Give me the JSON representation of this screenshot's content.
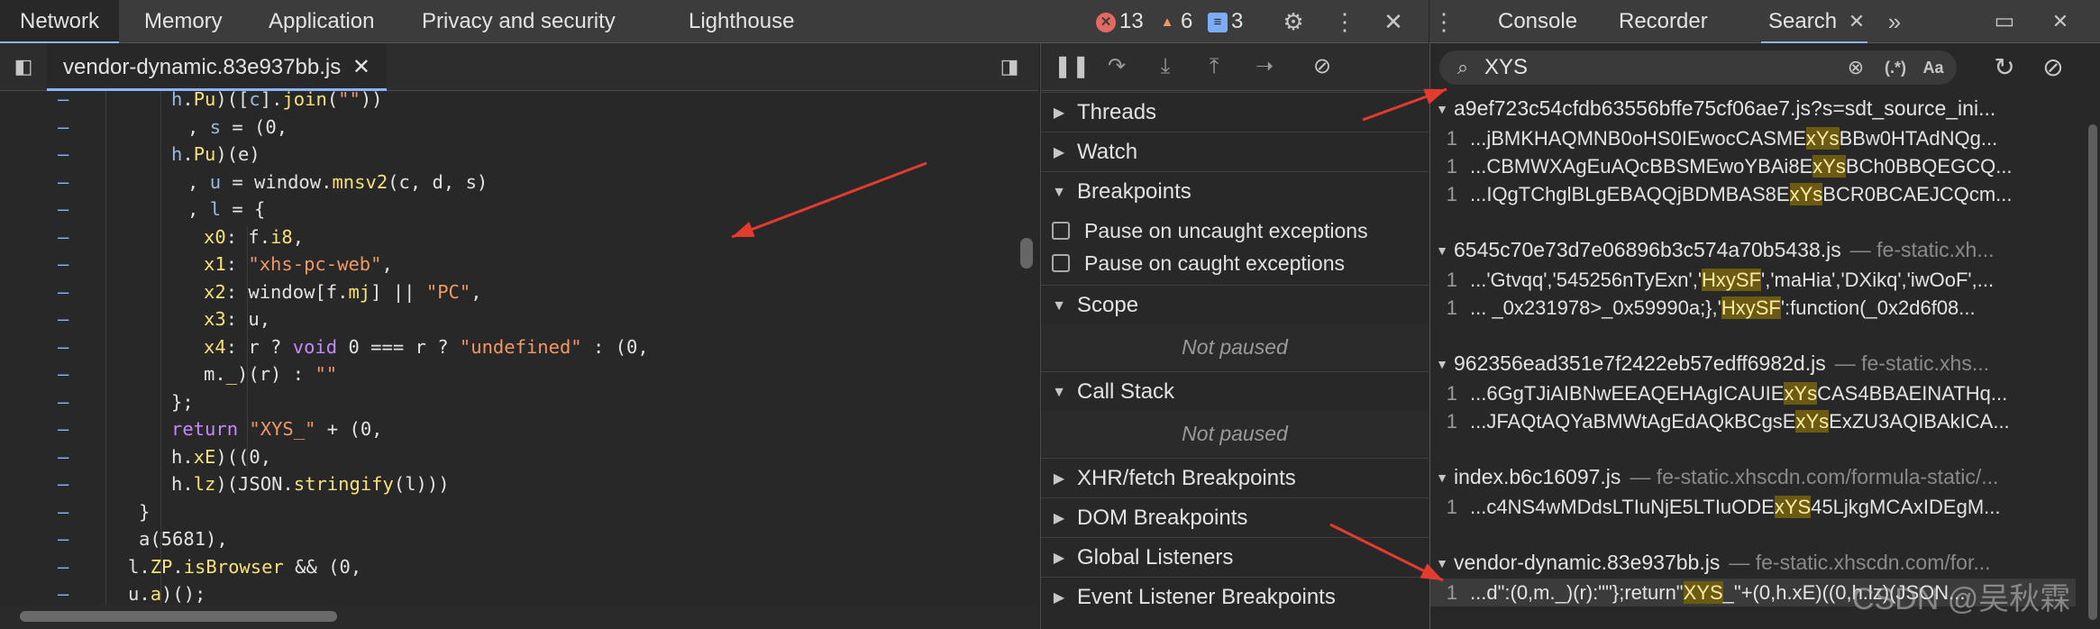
{
  "top_tabs": [
    "Network",
    "Memory",
    "Application",
    "Privacy and security",
    "Lighthouse"
  ],
  "active_top_tab": "Network",
  "counts": {
    "errors": "13",
    "warnings": "6",
    "messages": "3"
  },
  "right_tabs": {
    "console": "Console",
    "recorder": "Recorder",
    "search": "Search"
  },
  "editor": {
    "file_tab": "vendor-dynamic.83e937bb.js",
    "lines": [
      {
        "html": "<span class=\"prop\">h</span>.<span class=\"fn\">Pu</span>)([<span class=\"prop\">c</span>].<span class=\"fn\">join</span>(<span class=\"str\">\"\"</span>))",
        "indent": 190
      },
      {
        "html": ", <span class=\"prop\">s</span> = (0,",
        "indent": 208
      },
      {
        "html": "<span class=\"prop\">h</span>.<span class=\"fn\">Pu</span>)(e)",
        "indent": 190
      },
      {
        "html": ", <span class=\"prop\">u</span> = window.<span class=\"fn\">mnsv2</span>(c, d, s)",
        "indent": 208
      },
      {
        "html": ", <span class=\"prop\">l</span> = {",
        "indent": 208
      },
      {
        "html": "<span class=\"fn\">x0</span>: f.<span class=\"fn\">i8</span>,",
        "indent": 226
      },
      {
        "html": "<span class=\"fn\">x1</span>: <span class=\"str\">\"xhs-pc-web\"</span>,",
        "indent": 226
      },
      {
        "html": "<span class=\"fn\">x2</span>: window[f.<span class=\"fn\">mj</span>] || <span class=\"str\">\"PC\"</span>,",
        "indent": 226
      },
      {
        "html": "<span class=\"fn\">x3</span>: u,",
        "indent": 226
      },
      {
        "html": "<span class=\"fn\">x4</span>: r ? <span class=\"kw\">void</span> 0 === r ? <span class=\"str\">\"undefined\"</span> : (0,",
        "indent": 226
      },
      {
        "html": "m.<span class=\"fn\">_</span>)(r) : <span class=\"str\">\"\"</span>",
        "indent": 226
      },
      {
        "html": "};",
        "indent": 190
      },
      {
        "html": "<span class=\"kw\">return</span> <span class=\"str\">\"XYS_\"</span> + (0,",
        "indent": 190
      },
      {
        "html": "h.<span class=\"fn\">xE</span>)((0,",
        "indent": 190
      },
      {
        "html": "h.<span class=\"fn\">lz</span>)(JSON.<span class=\"fn\">stringify</span>(l)))",
        "indent": 190
      },
      {
        "html": "}",
        "indent": 154
      },
      {
        "html": "a(5681),",
        "indent": 154
      },
      {
        "html": "l.<span class=\"fn\">ZP</span>.<span class=\"fn\">isBrowser</span> && (0,",
        "indent": 142
      },
      {
        "html": "u.<span class=\"fn\">a</span>)();",
        "indent": 142
      }
    ]
  },
  "debugger": {
    "sections": {
      "threads": "Threads",
      "watch": "Watch",
      "breakpoints": "Breakpoints",
      "pause_uncaught": "Pause on uncaught exceptions",
      "pause_caught": "Pause on caught exceptions",
      "scope": "Scope",
      "not_paused": "Not paused",
      "call_stack": "Call Stack",
      "xhr": "XHR/fetch Breakpoints",
      "dom": "DOM Breakpoints",
      "global": "Global Listeners",
      "event": "Event Listener Breakpoints"
    }
  },
  "search": {
    "query": "XYS",
    "regex_label": "(.*)",
    "case_label": "Aa",
    "groups": [
      {
        "file": "a9ef723c54cfdb63556bffe75cf06ae7.js?s=sdt_source_ini...",
        "path": "",
        "matches": [
          {
            "ln": "1",
            "pre": "...jBMKHAQMNB0oHS0IEwocCASME",
            "hit": "xYs",
            "post": "BBw0HTAdNQg..."
          },
          {
            "ln": "1",
            "pre": "...CBMWXAgEuAQcBBSMEwoYBAi8E",
            "hit": "xYs",
            "post": "BCh0BBQEGCQ..."
          },
          {
            "ln": "1",
            "pre": "...IQgTChglBLgEBAQQjBDMBAS8E",
            "hit": "xYs",
            "post": "BCR0BCAEJCQcm..."
          }
        ]
      },
      {
        "file": "6545c70e73d7e06896b3c574a70b5438.js",
        "path": "— fe-static.xh...",
        "matches": [
          {
            "ln": "1",
            "pre": "...'Gtvqq','545256nTyExn','",
            "hit": "HxySF",
            "post": "','maHia','DXikq','iwOoF',..."
          },
          {
            "ln": "1",
            "pre": "... _0x231978>_0x59990a;},'",
            "hit": "HxySF",
            "post": "':function(_0x2d6f08..."
          }
        ]
      },
      {
        "file": "962356ead351e7f2422eb57edff6982d.js",
        "path": "— fe-static.xhs...",
        "matches": [
          {
            "ln": "1",
            "pre": "...6GgTJiAIBNwEEAQEHAgICAUIE",
            "hit": "xYs",
            "post": "CAS4BBAEINATHq..."
          },
          {
            "ln": "1",
            "pre": "...JFAQtAQYaBMWtAgEdAQkBCgsE",
            "hit": "xYs",
            "post": "ExZU3AQIBAkICA..."
          }
        ]
      },
      {
        "file": "index.b6c16097.js",
        "path": "— fe-static.xhscdn.com/formula-static/...",
        "matches": [
          {
            "ln": "1",
            "pre": "...c4NS4wMDdsLTIuNjE5LTIuODE",
            "hit": "xYS",
            "post": "45LjkgMCAxIDEgM..."
          }
        ]
      },
      {
        "file": "vendor-dynamic.83e937bb.js",
        "path": "— fe-static.xhscdn.com/for...",
        "matches": [
          {
            "ln": "1",
            "pre": "...d\":(0,m._)(r):\"\"};return\"",
            "hit": "XYS",
            "post": "_\"+(0,h.xE)((0,h.lz)(JSON..."
          }
        ]
      }
    ]
  },
  "watermark": "CSDN @吴秋霖",
  "colors": {
    "accent": "#8ab4f8",
    "error": "#e46962",
    "warning": "#f29766",
    "info": "#7cacf8",
    "arrow": "#e33b2e",
    "highlight": "#6b5a12"
  }
}
